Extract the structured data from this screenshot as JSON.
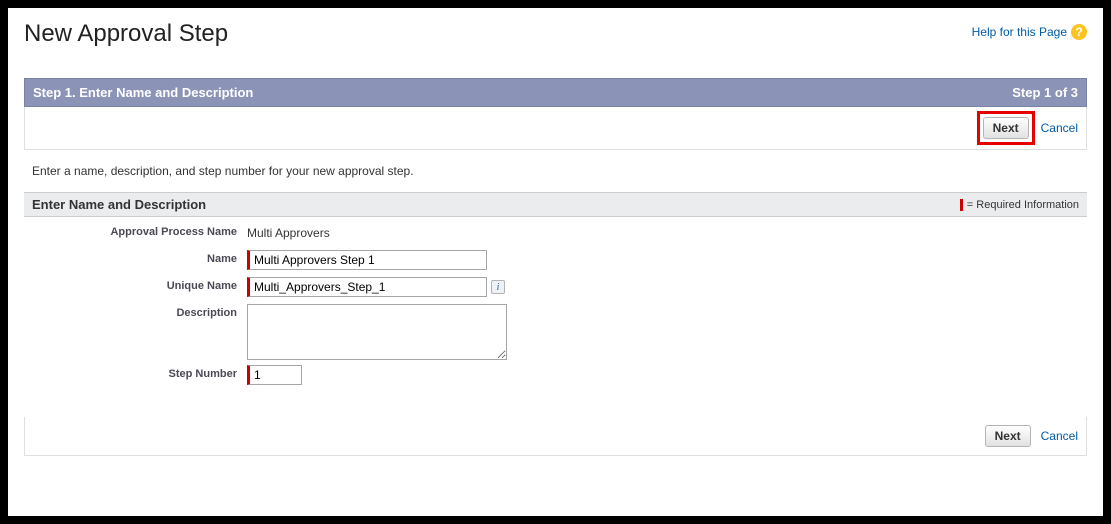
{
  "pageTitle": "New Approval Step",
  "helpLink": "Help for this Page",
  "stepHeader": {
    "title": "Step 1. Enter Name and Description",
    "counter": "Step 1 of 3"
  },
  "actions": {
    "next": "Next",
    "cancel": "Cancel"
  },
  "instruction": "Enter a name, description, and step number for your new approval step.",
  "section": {
    "title": "Enter Name and Description",
    "required": "= Required Information"
  },
  "fields": {
    "approvalProcessName": {
      "label": "Approval Process Name",
      "value": "Multi Approvers"
    },
    "name": {
      "label": "Name",
      "value": "Multi Approvers Step 1"
    },
    "uniqueName": {
      "label": "Unique Name",
      "value": "Multi_Approvers_Step_1"
    },
    "description": {
      "label": "Description",
      "value": ""
    },
    "stepNumber": {
      "label": "Step Number",
      "value": "1"
    }
  }
}
